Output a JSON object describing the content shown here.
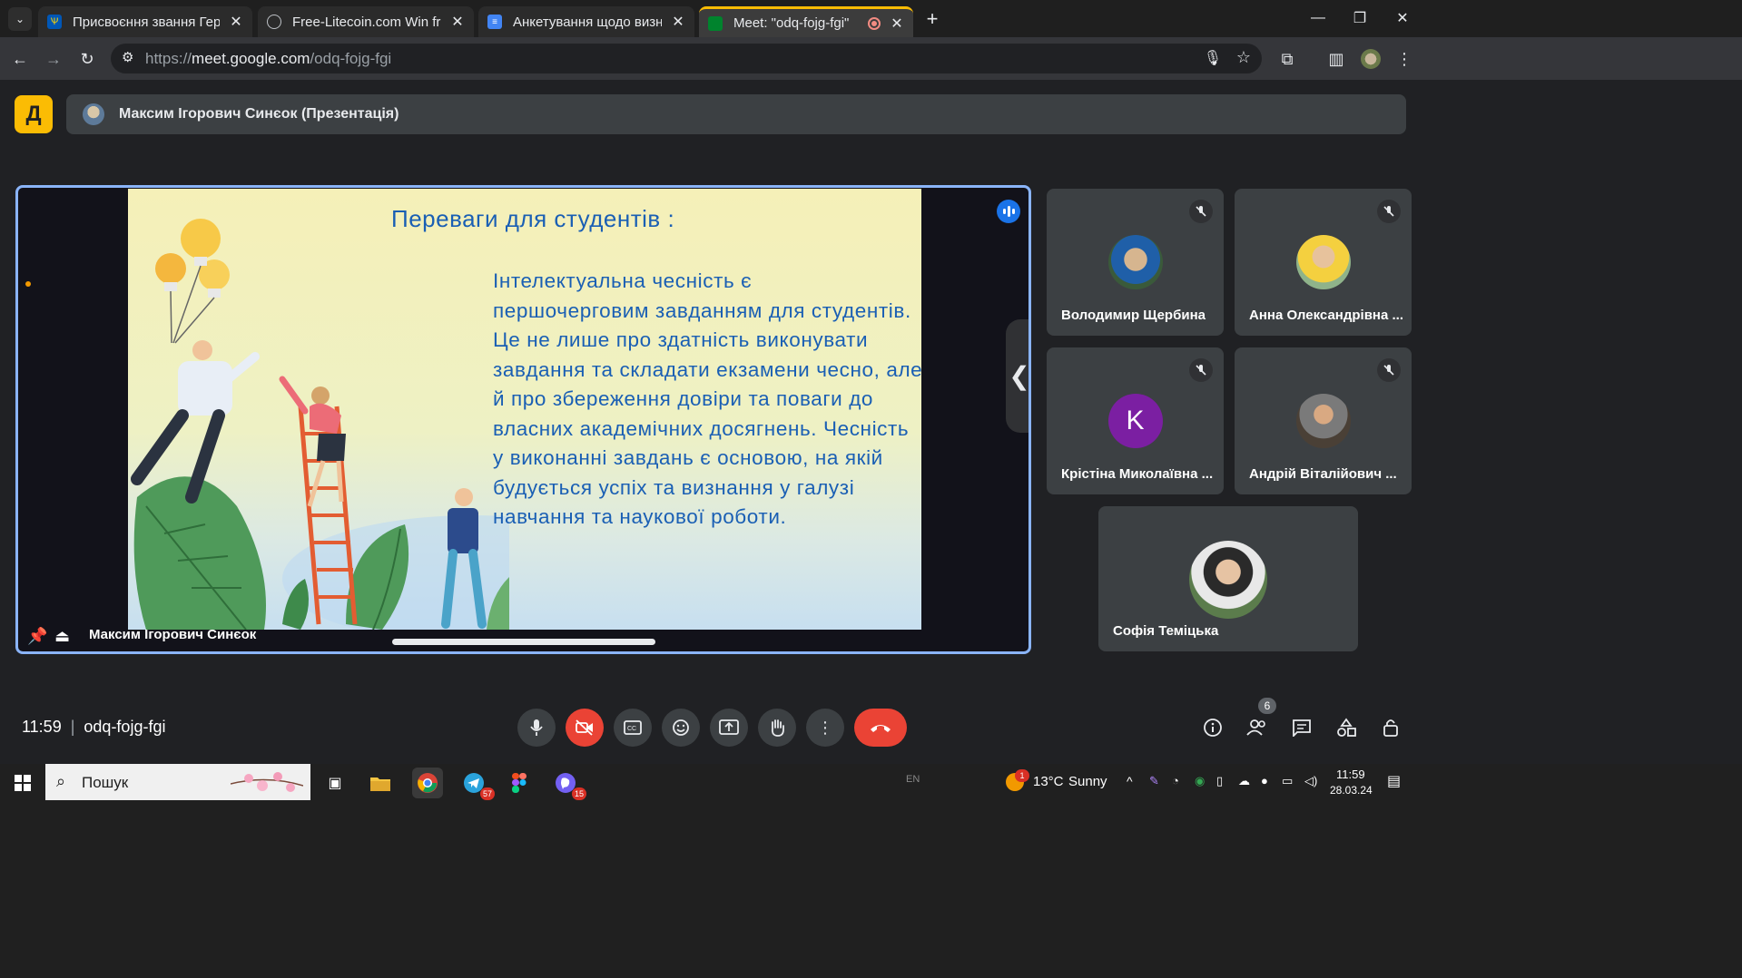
{
  "browser": {
    "tabs": [
      {
        "title": "Присвоєння звання Героя Укр",
        "favicon": "trident-icon"
      },
      {
        "title": "Free-Litecoin.com Win free Lite",
        "favicon": "globe-icon"
      },
      {
        "title": "Анкетування щодо визначенн",
        "favicon": "forms-icon"
      },
      {
        "title": "Meet: \"odq-fojg-fgi\"",
        "favicon": "meet-icon",
        "active": true
      }
    ],
    "url_prefix": "https://",
    "url_domain": "meet.google.com",
    "url_path": "/odq-fojg-fgi"
  },
  "meet": {
    "logo_letter": "Д",
    "presenter_bar": "Максим Ігорович Синєок (Презентація)",
    "slide": {
      "title": "Переваги для студентів :",
      "lines": [
        "Інтелектуальна чесність  є",
        "першочерговим завданням для студентів.",
        "Це не лише про здатність виконувати",
        "завдання та складати екзамени чесно, але",
        "й про збереження довіри та поваги до",
        "власних академічних досягнень. Чесність",
        "у виконанні завдань є основою, на якій",
        "будується успіх та визнання у галузі",
        "навчання та наукової роботи."
      ]
    },
    "main_name": "Максим Ігорович Синєок",
    "participants": [
      {
        "name": "Володимир Щербина",
        "avatar": "photo"
      },
      {
        "name": "Анна Олександрівна ...",
        "avatar": "photo"
      },
      {
        "name": "Крістіна Миколаївна ...",
        "avatar": "letter",
        "letter": "K"
      },
      {
        "name": "Андрій Віталійович ...",
        "avatar": "photo"
      },
      {
        "name": "Софія Теміцька",
        "avatar": "photo"
      }
    ],
    "time": "11:59",
    "meeting_code": "odq-fojg-fgi",
    "people_count": "6"
  },
  "taskbar": {
    "search_label": "Пошук",
    "lang": "EN",
    "weather_temp": "13°C",
    "weather_text": "Sunny",
    "weather_badge": "1",
    "telegram_badge": "57",
    "viber_badge": "15",
    "clock_time": "11:59",
    "clock_date": "28.03.24"
  },
  "colors": {
    "accent": "#8ab4f8",
    "leave": "#ea4335",
    "slide_text": "#1a5fb4",
    "meet_yellow": "#fbbc04"
  }
}
